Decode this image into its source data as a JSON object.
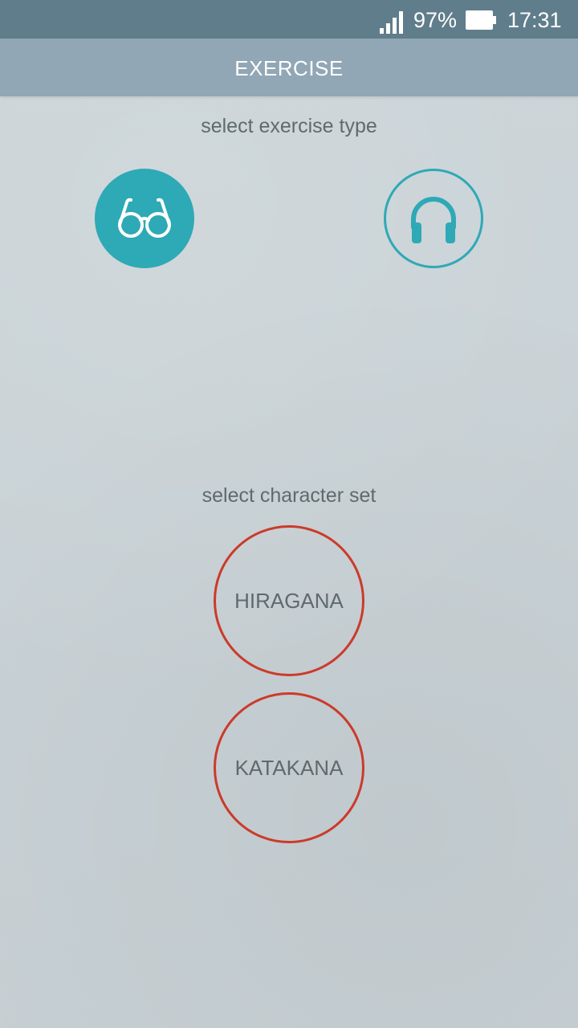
{
  "status_bar": {
    "battery_percent": "97%",
    "time": "17:31",
    "icons": [
      "signal-icon",
      "battery-icon"
    ]
  },
  "app_bar": {
    "title": "EXERCISE"
  },
  "exercise_type": {
    "label": "select exercise type",
    "options": [
      {
        "name": "reading",
        "icon": "glasses-icon",
        "selected": true
      },
      {
        "name": "listening",
        "icon": "headphones-icon",
        "selected": false
      }
    ]
  },
  "character_set": {
    "label": "select character set",
    "options": [
      "HIRAGANA",
      "KATAKANA"
    ]
  },
  "colors": {
    "status_bar": "#607d8b",
    "app_bar": "#91a7b6",
    "accent_teal": "#2ea9b6",
    "accent_red": "#cc3a2a",
    "background": "#c9d2d6",
    "text": "#5f6a6f"
  }
}
